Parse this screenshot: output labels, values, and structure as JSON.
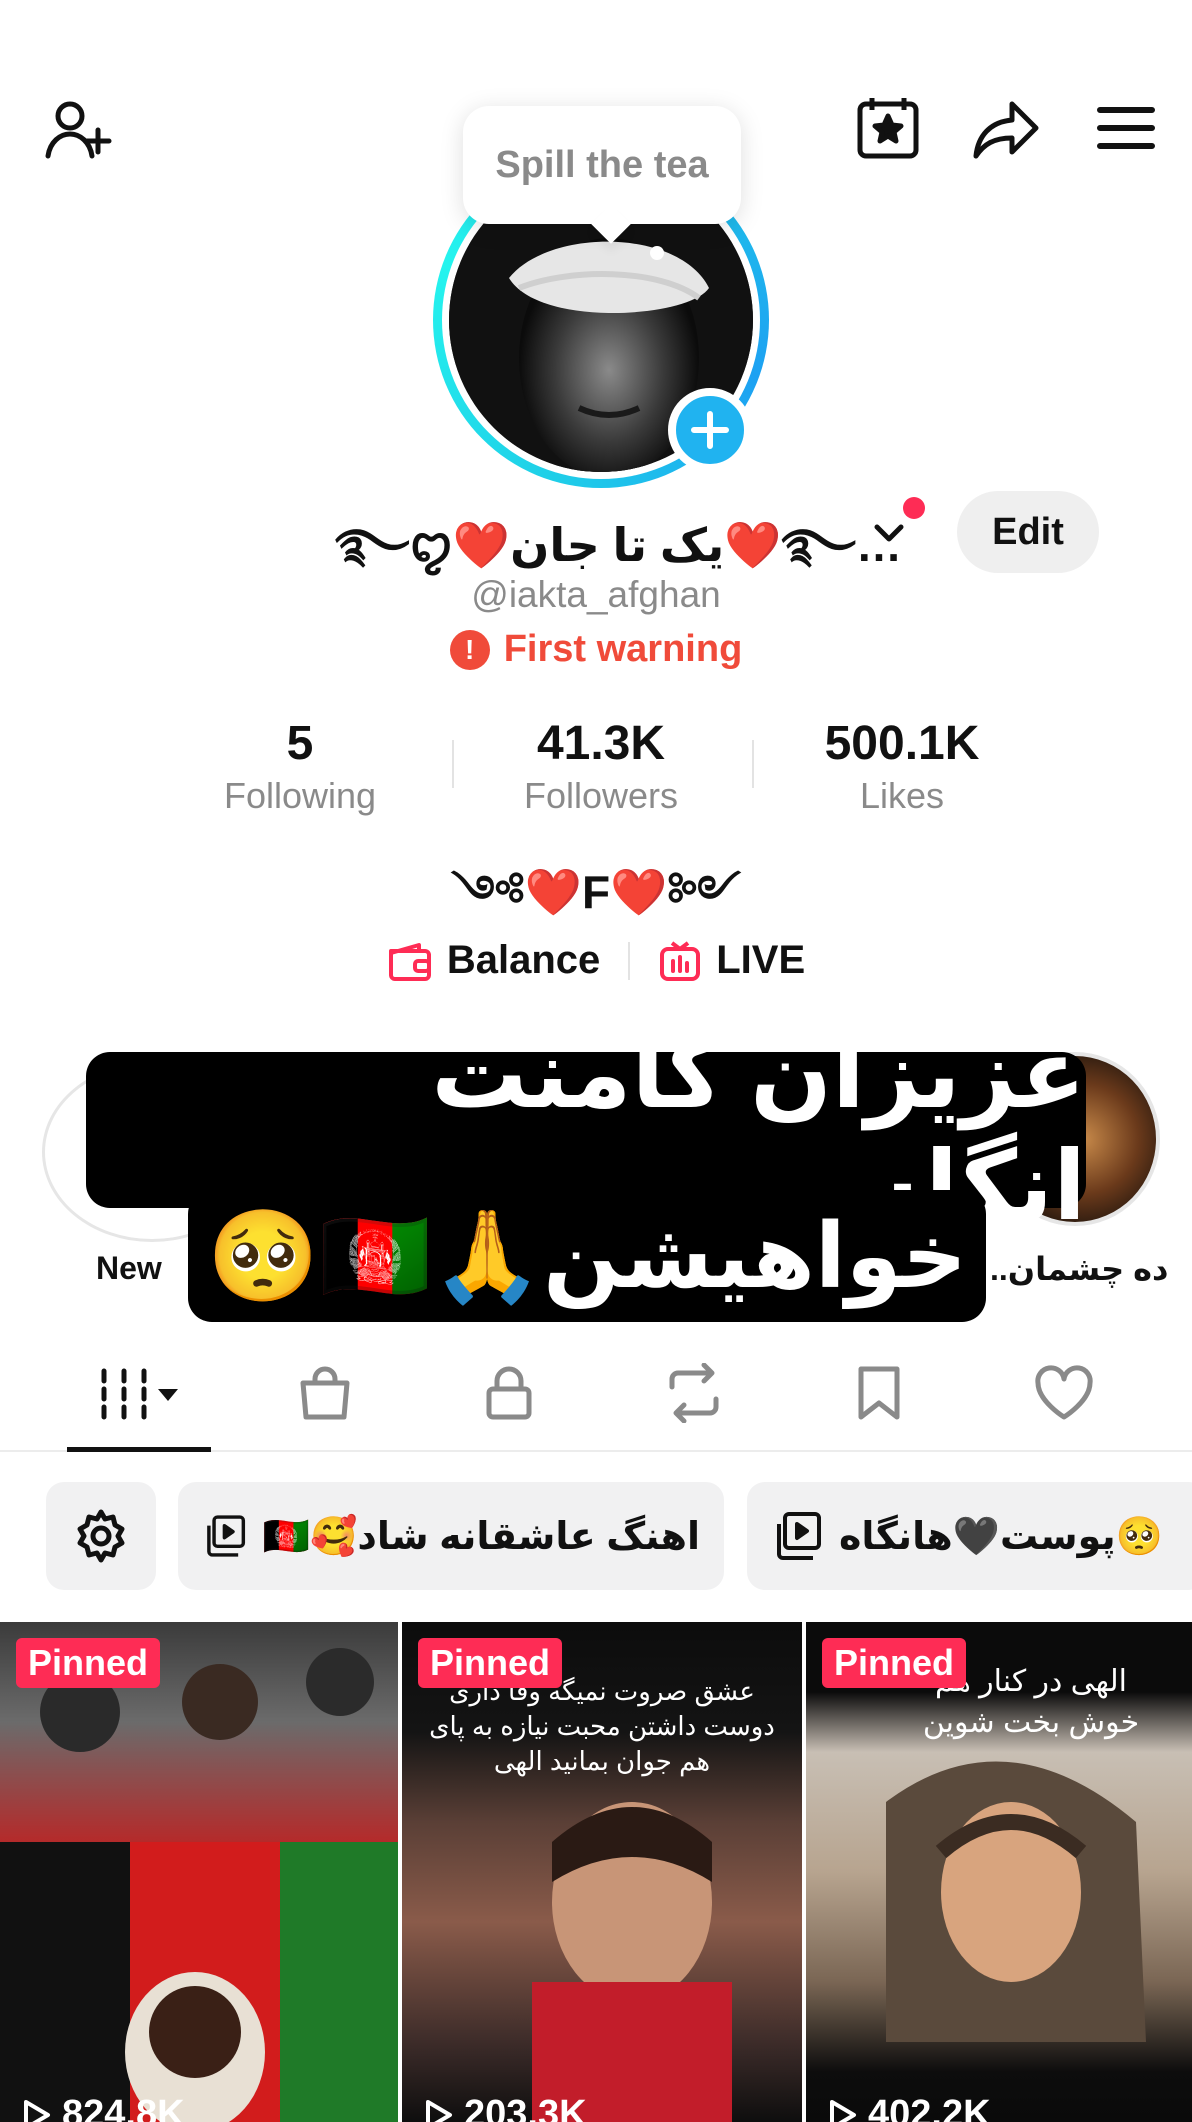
{
  "tooltip": {
    "text": "Spill the tea"
  },
  "profile": {
    "display_name": "…࿐❤️یک تا جان❤️࿐ꨄ︎",
    "username": "@iakta_afghan",
    "warning": "First warning",
    "edit_label": "Edit",
    "bio": "༺❤️F❤️༻"
  },
  "stats": [
    {
      "value": "5",
      "label": "Following"
    },
    {
      "value": "41.3K",
      "label": "Followers"
    },
    {
      "value": "500.1K",
      "label": "Likes"
    }
  ],
  "links": {
    "balance": "Balance",
    "live": "LIVE"
  },
  "highlights": {
    "new_label": "New",
    "second_label": "ده چشمان.."
  },
  "overlay": {
    "line1": "عزیزان کامنت انگلسی",
    "line2": "خواهیشن🙏🇦🇫🥺"
  },
  "chips": [
    {
      "label": "اهنگ عاشقانه شاد🥰🇦🇫"
    },
    {
      "label": "🥺پوست🖤هانگاه"
    }
  ],
  "videos": [
    {
      "pinned": "Pinned",
      "views": "824.8K",
      "caption": ""
    },
    {
      "pinned": "Pinned",
      "views": "203.3K",
      "caption": "عشق صروت نمیگه وفا داری دوست داشتن محبت نیازه به پای هم جوان بمانید الهی"
    },
    {
      "pinned": "Pinned",
      "views": "402.2K",
      "caption": "الهی در کنار هم خوش بخت شوین"
    }
  ],
  "colors": {
    "accent_red": "#fe2c55",
    "warning_red": "#f04b3a",
    "avatar_ring": "#25f4ee",
    "plus_badge": "#20b3f0"
  }
}
